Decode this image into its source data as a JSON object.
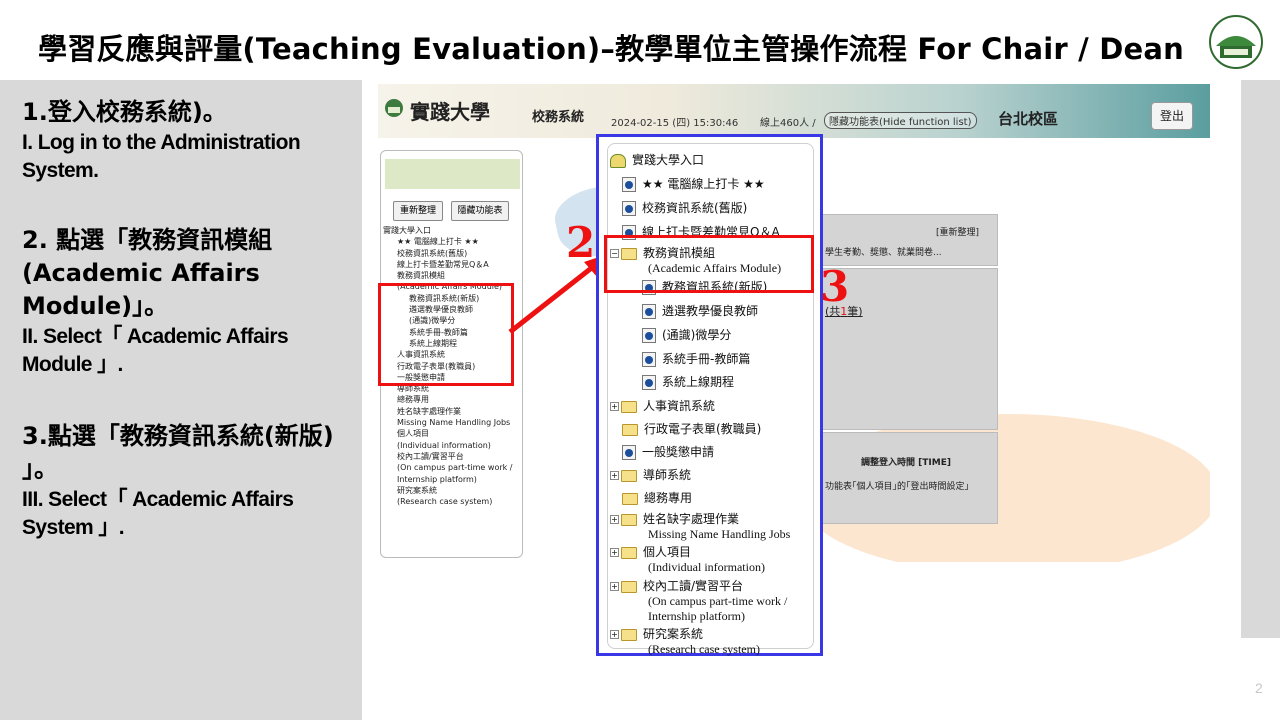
{
  "slide": {
    "title": "學習反應與評量(Teaching Evaluation)–教學單位主管操作流程 For Chair / Dean",
    "page_number": "2"
  },
  "steps": [
    {
      "zh": "1.登入校務系統)。",
      "en": "I. Log in to the Administration System."
    },
    {
      "zh": "2. 點選「教務資訊模組(Academic Affairs Module)」。",
      "en": "II. Select「 Academic Affairs Module 」."
    },
    {
      "zh": "3.點選「教務資訊系統(新版) 」。",
      "en": "III. Select「 Academic Affairs System 」."
    }
  ],
  "screenshot": {
    "school_name": "實踐大學",
    "system_name": "校務系統",
    "datetime": "2024-02-15 (四) 15:30:46",
    "online": "線上460人 /",
    "hide_function": "隱藏功能表(Hide function list)",
    "campus": "台北校區",
    "logout": "登出",
    "refresh_link": "[重新整理]",
    "notice_text": "學生考勤、獎懲、就業問卷...",
    "count_text": "(共",
    "count_value": "1",
    "count_unit": "筆)",
    "login_time_title": "調整登入時間 [TIME]",
    "login_time_text": "功能表｢個人項目｣的｢登出時間設定｣"
  },
  "mini_menu": {
    "refresh_btn": "重新整理",
    "hide_btn": "隱藏功能表",
    "items": [
      "實踐大學入口",
      "★★ 電腦線上打卡 ★★",
      "校務資訊系統(舊版)",
      "線上打卡暨差勤常見Q＆A",
      "教務資訊模組",
      "(Academic Affairs Module)",
      "教務資訊系統(新版)",
      "遴選教學優良教師",
      "(通識)微學分",
      "系統手冊-教師篇",
      "系統上線期程",
      "人事資訊系統",
      "行政電子表單(教職員)",
      "一般獎懲申請",
      "導師系統",
      "總務專用",
      "姓名缺字處理作業",
      "Missing Name Handling Jobs",
      "個人項目",
      "(Individual information)",
      "校內工讀/實習平台",
      "(On campus part-time work /",
      "Internship platform)",
      "研究案系統",
      "(Research case system)"
    ]
  },
  "tree": {
    "root": "實踐大學入口",
    "punch": "★★ 電腦線上打卡 ★★",
    "old_system": "校務資訊系統(舊版)",
    "faq": "線上打卡暨差勤常見Q＆A",
    "academic_module": "教務資訊模組",
    "academic_module_en": "(Academic Affairs Module)",
    "academic_system": "教務資訊系統(新版)",
    "select_teacher": "遴選教學優良教師",
    "micro_credit": "(通識)微學分",
    "manual": "系統手冊-教師篇",
    "schedule": "系統上線期程",
    "hr": "人事資訊系統",
    "eform": "行政電子表單(教職員)",
    "award": "一般獎懲申請",
    "mentor": "導師系統",
    "general_affairs": "總務專用",
    "missing_name": "姓名缺字處理作業",
    "missing_name_en": "Missing Name Handling Jobs",
    "personal": "個人項目",
    "personal_en": "(Individual information)",
    "parttime": "校內工讀/實習平台",
    "parttime_en1": "(On campus part-time work /",
    "parttime_en2": "Internship platform)",
    "research": "研究案系統",
    "research_en": "(Research case system)"
  },
  "markers": {
    "two": "2",
    "three": "3"
  },
  "colors": {
    "highlight_red": "#ee1111",
    "zoom_blue": "#3838e6",
    "panel_gray": "#d9d9d9"
  }
}
